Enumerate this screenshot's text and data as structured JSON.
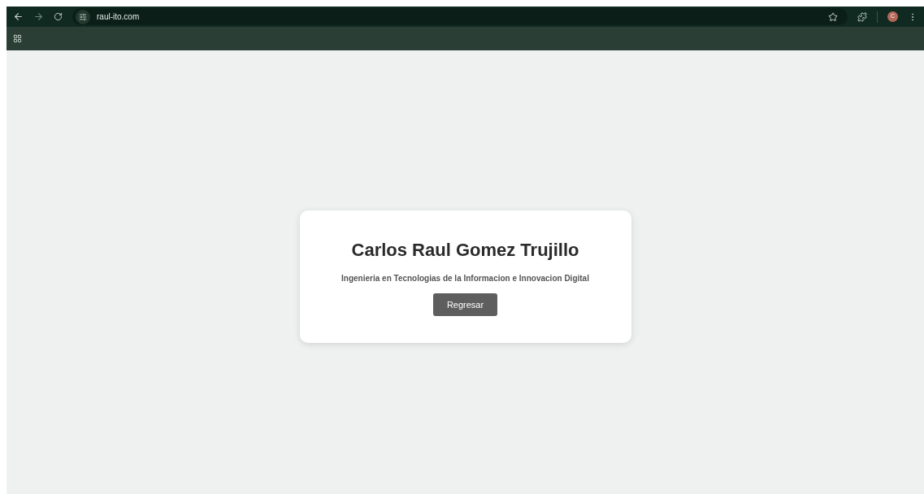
{
  "browser": {
    "url": "raul-ito.com",
    "avatar_letter": "C"
  },
  "card": {
    "title": "Carlos Raul Gomez Trujillo",
    "subtitle": "Ingenieria en Tecnologias de la Informacion e Innovacion Digital",
    "button": "Regresar"
  }
}
